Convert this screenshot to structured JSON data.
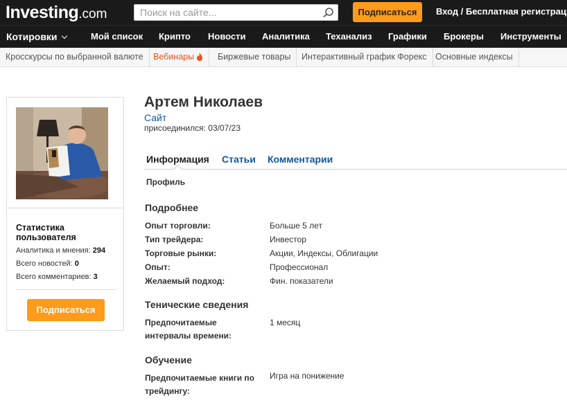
{
  "header": {
    "logo_main": "Investing",
    "logo_suffix": ".com",
    "search_placeholder": "Поиск на сайте...",
    "subscribe_label": "Подписаться",
    "login_label": "Вход / Бесплатная регистрация"
  },
  "nav": {
    "items": [
      "Котировки",
      "Мой список",
      "Крипто",
      "Новости",
      "Аналитика",
      "Теханализ",
      "Графики",
      "Брокеры",
      "Инструменты"
    ]
  },
  "subnav": {
    "items": [
      "Кросскурсы по выбранной валюте",
      "Вебинары",
      "Биржевые товары",
      "Интерактивный график Форекс",
      "Основные индексы"
    ]
  },
  "sidebar": {
    "stats_title": "Статистика пользователя",
    "stats": [
      {
        "label": "Аналитика и мнения:",
        "value": "294"
      },
      {
        "label": "Всего новостей:",
        "value": "0"
      },
      {
        "label": "Всего комментариев:",
        "value": "3"
      }
    ],
    "subscribe_label": "Подписаться"
  },
  "profile": {
    "name": "Артем Николаев",
    "site_link": "Сайт",
    "joined": "присоединился: 03/07/23",
    "tabs": [
      "Информация",
      "Статьи",
      "Комментарии"
    ],
    "subtab": "Профиль"
  },
  "details": {
    "title": "Подробнее",
    "rows": [
      {
        "label": "Опыт торговли:",
        "value": "Больше 5 лет"
      },
      {
        "label": "Тип трейдера:",
        "value": "Инвестор"
      },
      {
        "label": "Торговые рынки:",
        "value": "Акции, Индексы, Облигации"
      },
      {
        "label": "Опыт:",
        "value": "Профессионал"
      },
      {
        "label": "Желаемый подход:",
        "value": "Фин. показатели"
      }
    ]
  },
  "technical": {
    "title": "Тенические сведения",
    "rows": [
      {
        "label": "Предпочитаемые интервалы времени:",
        "value": "1 месяц"
      }
    ]
  },
  "education": {
    "title": "Обучение",
    "rows": [
      {
        "label": "Предпочитаемые книги по трейдингу:",
        "value": "Игра на понижение"
      }
    ]
  },
  "colors": {
    "header_bg": "#1a1a1a",
    "accent_orange": "#ff9b1b",
    "link_blue": "#1256a0",
    "hot_orange": "#e8521c"
  },
  "icons": [
    "search-icon",
    "chevron-down-icon",
    "flame-icon"
  ]
}
